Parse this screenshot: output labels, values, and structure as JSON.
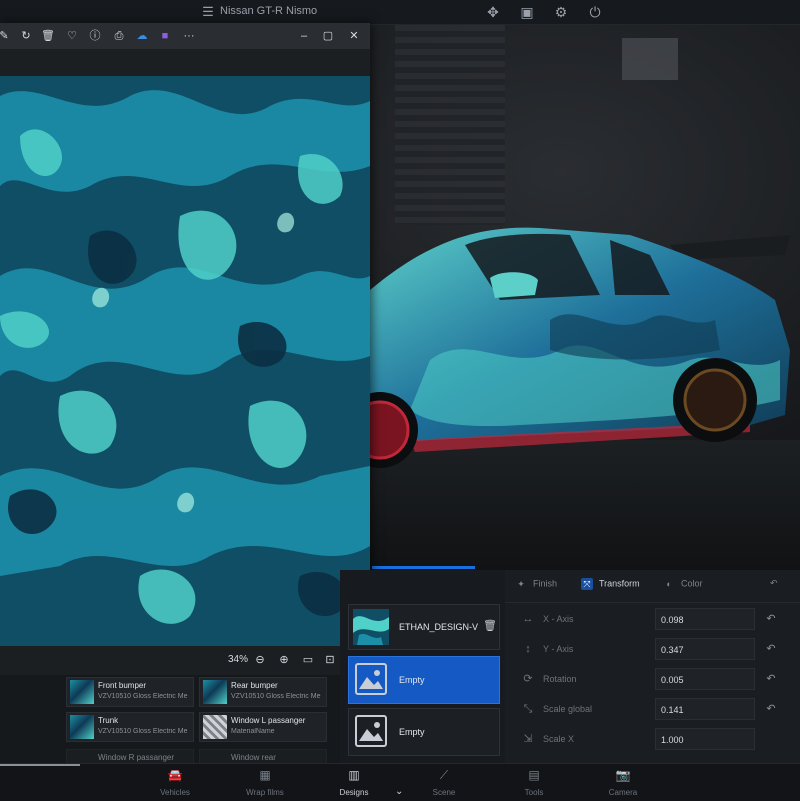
{
  "topbar": {
    "title": "Nissan GT-R Nismo",
    "icons": [
      "menu-icon",
      "move-icon",
      "save-icon",
      "gear-icon",
      "power-icon"
    ]
  },
  "viewer": {
    "toolbar_icons": [
      "edit-icon",
      "rotate-icon",
      "delete-icon",
      "heart-icon",
      "info-icon",
      "print-icon",
      "cloud-icon",
      "app-icon",
      "more-icon"
    ],
    "more_label": "···",
    "window_controls": {
      "minimize": "–",
      "maximize": "▢",
      "close": "✕"
    },
    "zoom": "34%"
  },
  "designs": {
    "items": [
      {
        "name": "Front bumper",
        "material": "VZV10510 Gloss Electric Me"
      },
      {
        "name": "Rear bumper",
        "material": "VZV10510 Gloss Electric Me"
      },
      {
        "name": "Trunk",
        "material": "VZV10510 Gloss Electric Me"
      },
      {
        "name": "Window L passanger",
        "material": "MaterialName"
      },
      {
        "name": "Window R passanger",
        "material": ""
      },
      {
        "name": "Window rear",
        "material": ""
      }
    ]
  },
  "layers": {
    "items": [
      {
        "name": "ETHAN_DESIGN-V",
        "type": "image"
      },
      {
        "name": "Empty",
        "type": "placeholder",
        "selected": true
      },
      {
        "name": "Empty",
        "type": "placeholder",
        "selected": false
      }
    ]
  },
  "properties": {
    "tabs": [
      {
        "label": "Finish",
        "active": false
      },
      {
        "label": "Transform",
        "active": true
      },
      {
        "label": "Color",
        "active": false
      }
    ],
    "rows": [
      {
        "label": "X - Axis",
        "value": "0.098"
      },
      {
        "label": "Y - Axis",
        "value": "0.347"
      },
      {
        "label": "Rotation",
        "value": "0.005"
      },
      {
        "label": "Scale global",
        "value": "0.141"
      },
      {
        "label": "Scale X",
        "value": "1.000"
      }
    ]
  },
  "nav": {
    "items": [
      {
        "label": "Vehicles",
        "icon": "car-icon"
      },
      {
        "label": "Wrap films",
        "icon": "film-icon"
      },
      {
        "label": "Designs",
        "icon": "designs-icon",
        "active": true
      },
      {
        "label": "Scene",
        "icon": "scene-icon"
      },
      {
        "label": "Tools",
        "icon": "tools-icon"
      },
      {
        "label": "Camera",
        "icon": "camera-icon"
      }
    ]
  },
  "colors": {
    "accent": "#1559c4",
    "pattern_light": "#4fd0c8",
    "pattern_dark": "#0f3a52",
    "car_rim": "#c0283a"
  }
}
